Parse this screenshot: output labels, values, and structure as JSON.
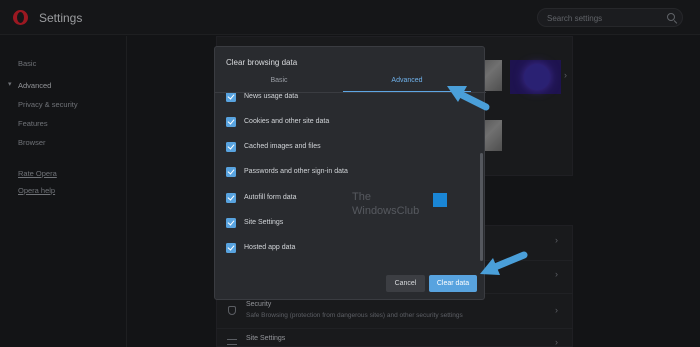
{
  "app": {
    "title": "Settings"
  },
  "search": {
    "placeholder": "Search settings"
  },
  "sidebar": {
    "items": [
      {
        "label": "Basic"
      },
      {
        "label": "Advanced"
      },
      {
        "label": "Privacy & security"
      },
      {
        "label": "Features"
      },
      {
        "label": "Browser"
      }
    ],
    "links": [
      {
        "label": "Rate Opera"
      },
      {
        "label": "Opera help"
      }
    ]
  },
  "background_sections": [
    {
      "title": "Security",
      "description": "Safe Browsing (protection from dangerous sites) and other security settings"
    },
    {
      "title": "Site Settings"
    }
  ],
  "dialog": {
    "title": "Clear browsing data",
    "tabs": [
      {
        "label": "Basic",
        "active": false
      },
      {
        "label": "Advanced",
        "active": true
      }
    ],
    "options": [
      {
        "label": "News usage data",
        "checked": true
      },
      {
        "label": "Cookies and other site data",
        "checked": true
      },
      {
        "label": "Cached images and files",
        "checked": true
      },
      {
        "label": "Passwords and other sign-in data",
        "checked": true
      },
      {
        "label": "Autofill form data",
        "checked": true
      },
      {
        "label": "Site Settings",
        "checked": true
      },
      {
        "label": "Hosted app data",
        "checked": true
      }
    ],
    "cancel_label": "Cancel",
    "confirm_label": "Clear data"
  },
  "watermark": {
    "line1": "The",
    "line2": "WindowsClub"
  },
  "colors": {
    "accent": "#58a3df",
    "arrow": "#4a9fd9",
    "brand": "#d7222f"
  }
}
